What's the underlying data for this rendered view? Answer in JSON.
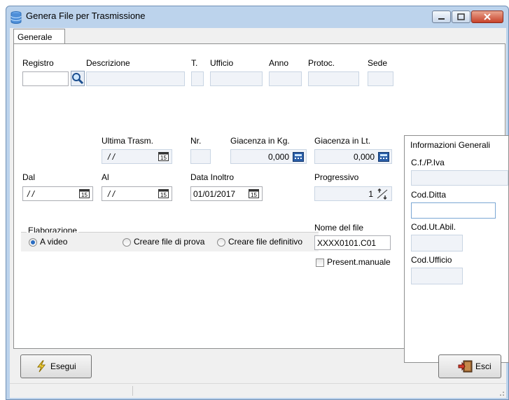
{
  "window": {
    "title": "Genera File per Trasmissione"
  },
  "tabs": [
    {
      "label": "Generale",
      "active": true
    }
  ],
  "header_row": {
    "registro_label": "Registro",
    "registro_value": "",
    "descrizione_label": "Descrizione",
    "descrizione_value": "",
    "t_label": "T.",
    "ufficio_label": "Ufficio",
    "anno_label": "Anno",
    "protoc_label": "Protoc.",
    "sede_label": "Sede"
  },
  "ultima_trasm": {
    "label": "Ultima Trasm.",
    "value": "/ /"
  },
  "nr": {
    "label": "Nr.",
    "value": ""
  },
  "giacenza_kg": {
    "label": "Giacenza in Kg.",
    "value": "0,000"
  },
  "giacenza_lt": {
    "label": "Giacenza in Lt.",
    "value": "0,000"
  },
  "dal": {
    "label": "Dal",
    "value": "/ /"
  },
  "al": {
    "label": "Al",
    "value": "/ /"
  },
  "data_inoltro": {
    "label": "Data Inoltro",
    "value": "01/01/2017"
  },
  "progressivo": {
    "label": "Progressivo",
    "value": "1"
  },
  "elaborazione": {
    "legend": "Elaborazione",
    "options": [
      {
        "label": "A video",
        "selected": true
      },
      {
        "label": "Creare file di prova",
        "selected": false
      },
      {
        "label": "Creare file definitivo",
        "selected": false
      }
    ]
  },
  "nome_file": {
    "label": "Nome del file",
    "value": "XXXX0101.C01"
  },
  "present_manuale": {
    "label": "Present.manuale",
    "checked": false
  },
  "calendar_icon_text": "15",
  "info_panel": {
    "title": "Informazioni Generali",
    "cf_label": "C.f./P.Iva",
    "cod_ditta_label": "Cod.Ditta",
    "cod_ut_abil_label": "Cod.Ut.Abil.",
    "cod_ufficio_label": "Cod.Ufficio"
  },
  "buttons": {
    "esegui": "Esegui",
    "esci": "Esci"
  },
  "colors": {
    "title_bar": "#bcd3ec",
    "close_button": "#c8422a",
    "field_bg": "#f0f3f8",
    "radio_selected": "#2a6dc2"
  },
  "icons": {
    "app": "database-icon",
    "search": "magnifier-icon",
    "calendar": "calendar-icon",
    "calculator": "calculator-icon",
    "spin": "spin-arrows-icon",
    "esegui": "lightning-icon",
    "esci": "exit-door-icon"
  }
}
